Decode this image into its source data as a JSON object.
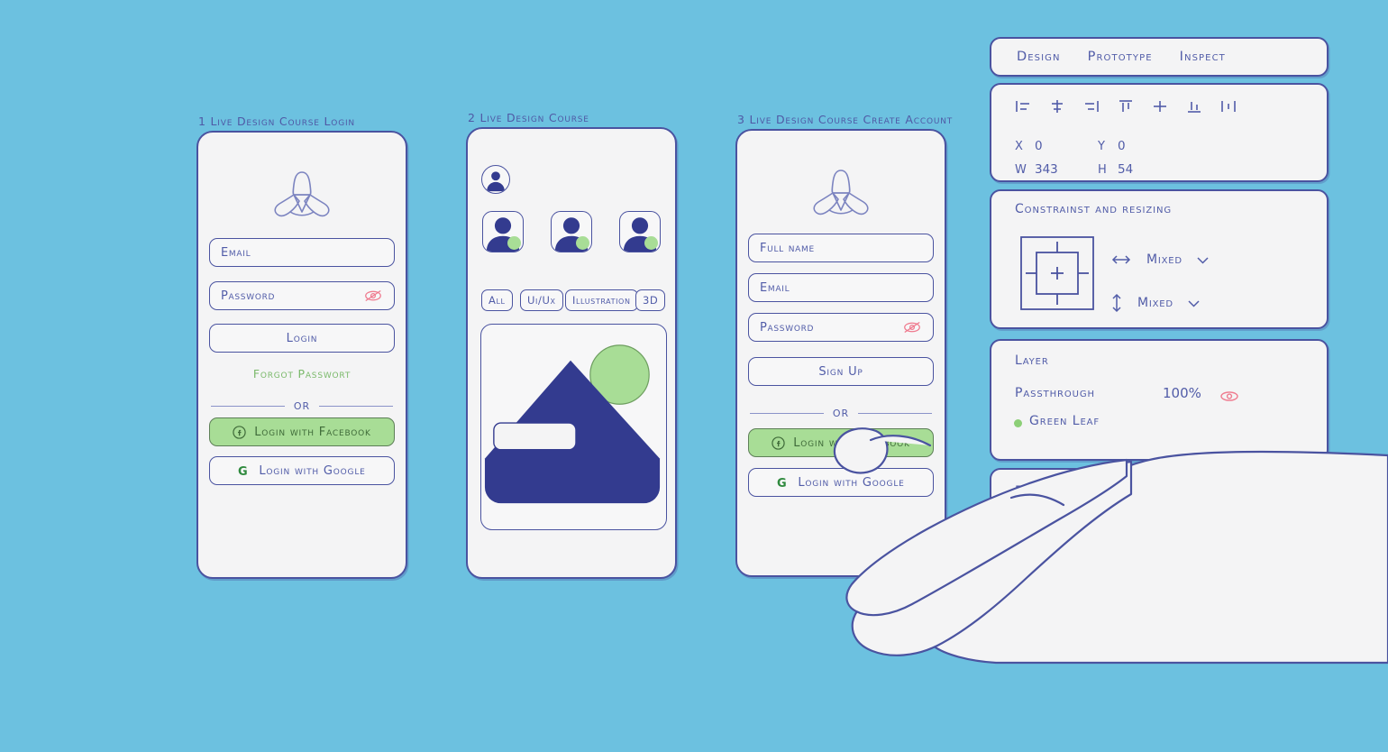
{
  "canvas": {
    "background_color": "#6cc1e0",
    "ink_color": "#4a53a0",
    "accent_green": "#a8dd96",
    "accent_navy": "#333b8f",
    "accent_pink": "#ef7a8e",
    "link_green": "#7ab96a"
  },
  "screens": [
    {
      "title": "1 Live Design  Course Login",
      "logo_icon": "trefoil-leaf-logo",
      "fields": [
        {
          "name": "email",
          "placeholder": "Email",
          "icon": null
        },
        {
          "name": "password",
          "placeholder": "Password",
          "icon": "eye-slash-icon"
        }
      ],
      "primary_button": "Login",
      "link": "Forgot Passwort",
      "divider": "OR",
      "social": [
        {
          "label": "Login with Facebook",
          "icon": "facebook-icon",
          "style": "green"
        },
        {
          "label": "Login with Google",
          "icon": "google-icon",
          "style": "white"
        }
      ]
    },
    {
      "title": "2 Live Design Course",
      "profile_icon": "user-avatar-icon",
      "avatars": [
        {
          "status": "online"
        },
        {
          "status": "online"
        },
        {
          "status": "online"
        }
      ],
      "chips": [
        "All",
        "Ui/Ux",
        "Illustration",
        "3D"
      ],
      "image_placeholder": {
        "icon": "mountain-image-placeholder",
        "sun_color": "#a8dd96",
        "mountain_color": "#333b8f"
      }
    },
    {
      "title": "3 Live Design Course   Create Account",
      "logo_icon": "trefoil-leaf-logo",
      "fields": [
        {
          "name": "full-name",
          "placeholder": "Full name",
          "icon": null
        },
        {
          "name": "email",
          "placeholder": "Email",
          "icon": null
        },
        {
          "name": "password",
          "placeholder": "Password",
          "icon": "eye-slash-icon"
        }
      ],
      "primary_button": "Sign Up",
      "divider": "OR",
      "social": [
        {
          "label": "Login with Facebook",
          "icon": "facebook-icon",
          "style": "green"
        },
        {
          "label": "Login with Google",
          "icon": "google-icon",
          "style": "white"
        }
      ]
    }
  ],
  "inspector": {
    "tabs": [
      "Design",
      "Prototype",
      "Inspect"
    ],
    "align_icons": [
      "align-left-icon",
      "align-center-horizontal-icon",
      "align-right-icon",
      "align-top-icon",
      "align-center-vertical-icon",
      "align-bottom-icon",
      "distribute-horizontal-icon"
    ],
    "dimensions": {
      "x_label": "X",
      "x_value": "0",
      "y_label": "Y",
      "y_value": "0",
      "w_label": "W",
      "w_value": "343",
      "h_label": "H",
      "h_value": "54"
    },
    "constraints": {
      "title": "Constrainst and resizing",
      "horizontal_icon": "horizontal-arrows-icon",
      "horizontal_value": "Mixed",
      "vertical_icon": "vertical-arrows-icon",
      "vertical_value": "Mixed",
      "chevron_icon": "chevron-down-icon"
    },
    "layer": {
      "title": "Layer",
      "blend_mode": "Passthrough",
      "opacity": "100%",
      "visibility_icon": "eye-slash-icon",
      "item_name": "Green Leaf",
      "item_dot_color": "#8ccf77"
    },
    "extra_rows": [
      {
        "label": "F",
        "add_icon": "plus-icon"
      },
      {
        "label": "",
        "add_icon": "plus-icon"
      }
    ]
  },
  "cursor": {
    "type": "hand-pointer-illustration",
    "target": "Login with Facebook"
  }
}
